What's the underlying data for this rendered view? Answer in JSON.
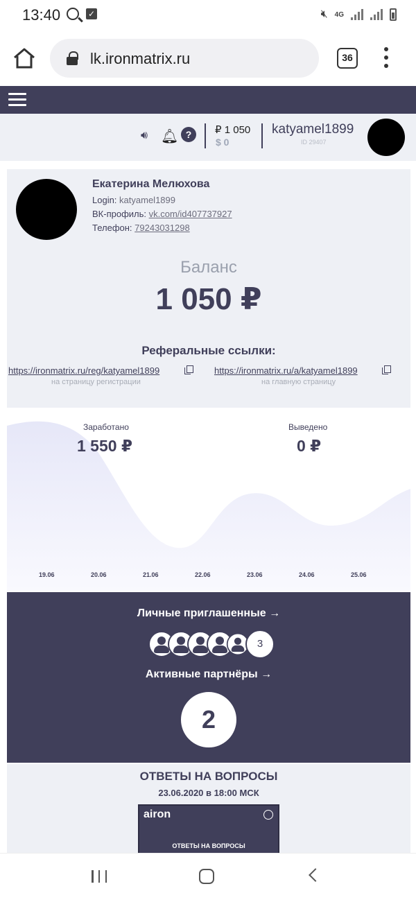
{
  "status_bar": {
    "time": "13:40",
    "network": "4G"
  },
  "browser": {
    "url": "lk.ironmatrix.ru",
    "tab_count": "36"
  },
  "userbar": {
    "balance_rub": "₽ 1 050",
    "balance_usd": "$ 0",
    "username": "katyamel1899",
    "user_id": "ID 29407"
  },
  "profile": {
    "name": "Екатерина Мелюхова",
    "login_label": "Login:",
    "login_value": "katyamel1899",
    "vk_label": "ВК-профиль:",
    "vk_value": "vk.com/id407737927",
    "phone_label": "Телефон:",
    "phone_value": "79243031298"
  },
  "balance": {
    "label": "Баланс",
    "value": "1 050 ₽"
  },
  "referral": {
    "title": "Реферальные ссылки:",
    "reg_link": "https://ironmatrix.ru/reg/katyamel1899",
    "reg_caption": "на страницу регистрации",
    "main_link": "https://ironmatrix.ru/a/katyamel1899",
    "main_caption": "на главную страницу"
  },
  "stats": {
    "earned_label": "Заработано",
    "earned_value": "1 550 ₽",
    "withdrawn_label": "Выведено",
    "withdrawn_value": "0 ₽"
  },
  "chart_data": {
    "type": "area",
    "categories": [
      "19.06",
      "20.06",
      "21.06",
      "22.06",
      "23.06",
      "24.06",
      "25.06"
    ]
  },
  "colors": {
    "accent": "#403f5a",
    "panel": "#eef0f5",
    "chart_fill": "#ebecfa"
  },
  "invites": {
    "personal_title": "Личные приглашенные →",
    "personal_count": "3",
    "partners_title": "Активные партнёры →",
    "partners_count": "2"
  },
  "qa": {
    "title": "ОТВЕТЫ НА ВОПРОСЫ",
    "date": "23.06.2020 в 18:00 МСК",
    "thumb_brand": "airon",
    "thumb_caption": "ОТВЕТЫ НА ВОПРОСЫ"
  }
}
